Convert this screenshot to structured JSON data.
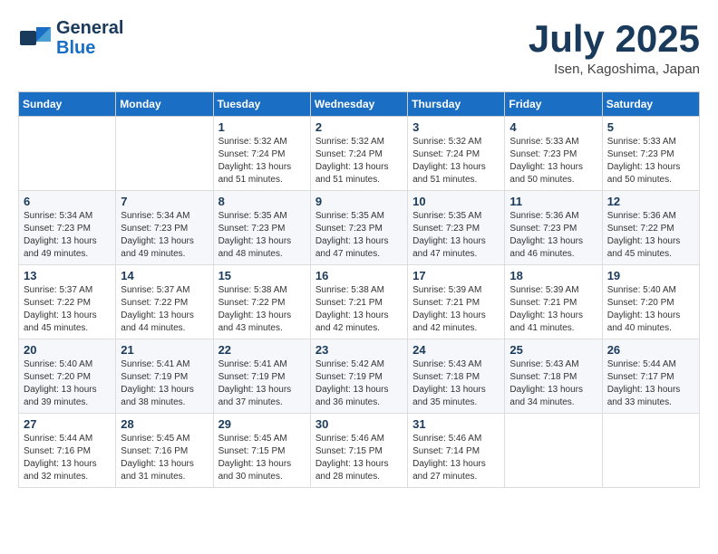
{
  "header": {
    "logo_line1": "General",
    "logo_line2": "Blue",
    "month": "July 2025",
    "location": "Isen, Kagoshima, Japan"
  },
  "weekdays": [
    "Sunday",
    "Monday",
    "Tuesday",
    "Wednesday",
    "Thursday",
    "Friday",
    "Saturday"
  ],
  "weeks": [
    [
      {
        "day": "",
        "info": ""
      },
      {
        "day": "",
        "info": ""
      },
      {
        "day": "1",
        "info": "Sunrise: 5:32 AM\nSunset: 7:24 PM\nDaylight: 13 hours\nand 51 minutes."
      },
      {
        "day": "2",
        "info": "Sunrise: 5:32 AM\nSunset: 7:24 PM\nDaylight: 13 hours\nand 51 minutes."
      },
      {
        "day": "3",
        "info": "Sunrise: 5:32 AM\nSunset: 7:24 PM\nDaylight: 13 hours\nand 51 minutes."
      },
      {
        "day": "4",
        "info": "Sunrise: 5:33 AM\nSunset: 7:23 PM\nDaylight: 13 hours\nand 50 minutes."
      },
      {
        "day": "5",
        "info": "Sunrise: 5:33 AM\nSunset: 7:23 PM\nDaylight: 13 hours\nand 50 minutes."
      }
    ],
    [
      {
        "day": "6",
        "info": "Sunrise: 5:34 AM\nSunset: 7:23 PM\nDaylight: 13 hours\nand 49 minutes."
      },
      {
        "day": "7",
        "info": "Sunrise: 5:34 AM\nSunset: 7:23 PM\nDaylight: 13 hours\nand 49 minutes."
      },
      {
        "day": "8",
        "info": "Sunrise: 5:35 AM\nSunset: 7:23 PM\nDaylight: 13 hours\nand 48 minutes."
      },
      {
        "day": "9",
        "info": "Sunrise: 5:35 AM\nSunset: 7:23 PM\nDaylight: 13 hours\nand 47 minutes."
      },
      {
        "day": "10",
        "info": "Sunrise: 5:35 AM\nSunset: 7:23 PM\nDaylight: 13 hours\nand 47 minutes."
      },
      {
        "day": "11",
        "info": "Sunrise: 5:36 AM\nSunset: 7:23 PM\nDaylight: 13 hours\nand 46 minutes."
      },
      {
        "day": "12",
        "info": "Sunrise: 5:36 AM\nSunset: 7:22 PM\nDaylight: 13 hours\nand 45 minutes."
      }
    ],
    [
      {
        "day": "13",
        "info": "Sunrise: 5:37 AM\nSunset: 7:22 PM\nDaylight: 13 hours\nand 45 minutes."
      },
      {
        "day": "14",
        "info": "Sunrise: 5:37 AM\nSunset: 7:22 PM\nDaylight: 13 hours\nand 44 minutes."
      },
      {
        "day": "15",
        "info": "Sunrise: 5:38 AM\nSunset: 7:22 PM\nDaylight: 13 hours\nand 43 minutes."
      },
      {
        "day": "16",
        "info": "Sunrise: 5:38 AM\nSunset: 7:21 PM\nDaylight: 13 hours\nand 42 minutes."
      },
      {
        "day": "17",
        "info": "Sunrise: 5:39 AM\nSunset: 7:21 PM\nDaylight: 13 hours\nand 42 minutes."
      },
      {
        "day": "18",
        "info": "Sunrise: 5:39 AM\nSunset: 7:21 PM\nDaylight: 13 hours\nand 41 minutes."
      },
      {
        "day": "19",
        "info": "Sunrise: 5:40 AM\nSunset: 7:20 PM\nDaylight: 13 hours\nand 40 minutes."
      }
    ],
    [
      {
        "day": "20",
        "info": "Sunrise: 5:40 AM\nSunset: 7:20 PM\nDaylight: 13 hours\nand 39 minutes."
      },
      {
        "day": "21",
        "info": "Sunrise: 5:41 AM\nSunset: 7:19 PM\nDaylight: 13 hours\nand 38 minutes."
      },
      {
        "day": "22",
        "info": "Sunrise: 5:41 AM\nSunset: 7:19 PM\nDaylight: 13 hours\nand 37 minutes."
      },
      {
        "day": "23",
        "info": "Sunrise: 5:42 AM\nSunset: 7:19 PM\nDaylight: 13 hours\nand 36 minutes."
      },
      {
        "day": "24",
        "info": "Sunrise: 5:43 AM\nSunset: 7:18 PM\nDaylight: 13 hours\nand 35 minutes."
      },
      {
        "day": "25",
        "info": "Sunrise: 5:43 AM\nSunset: 7:18 PM\nDaylight: 13 hours\nand 34 minutes."
      },
      {
        "day": "26",
        "info": "Sunrise: 5:44 AM\nSunset: 7:17 PM\nDaylight: 13 hours\nand 33 minutes."
      }
    ],
    [
      {
        "day": "27",
        "info": "Sunrise: 5:44 AM\nSunset: 7:16 PM\nDaylight: 13 hours\nand 32 minutes."
      },
      {
        "day": "28",
        "info": "Sunrise: 5:45 AM\nSunset: 7:16 PM\nDaylight: 13 hours\nand 31 minutes."
      },
      {
        "day": "29",
        "info": "Sunrise: 5:45 AM\nSunset: 7:15 PM\nDaylight: 13 hours\nand 30 minutes."
      },
      {
        "day": "30",
        "info": "Sunrise: 5:46 AM\nSunset: 7:15 PM\nDaylight: 13 hours\nand 28 minutes."
      },
      {
        "day": "31",
        "info": "Sunrise: 5:46 AM\nSunset: 7:14 PM\nDaylight: 13 hours\nand 27 minutes."
      },
      {
        "day": "",
        "info": ""
      },
      {
        "day": "",
        "info": ""
      }
    ]
  ]
}
